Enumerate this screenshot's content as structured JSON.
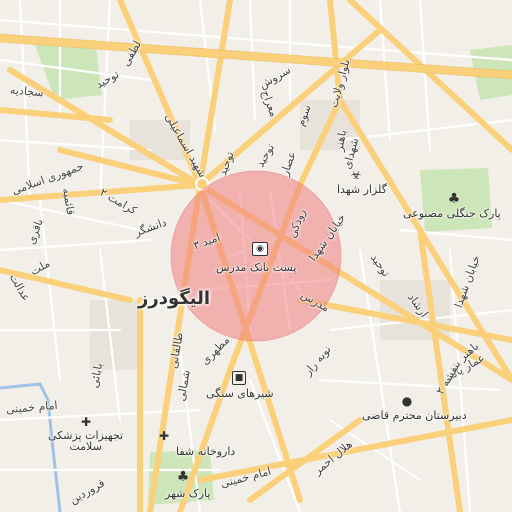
{
  "map": {
    "district_label": "الیگودرز",
    "highlight_color": "#f08080",
    "colors": {
      "background": "#f2efe9",
      "major_road": "#fdd37a",
      "minor_road": "#ffffff",
      "park": "#cfe8bd",
      "water": "#a9c9ea",
      "block": "#e4dfd6"
    },
    "pois": [
      {
        "id": "post-bank",
        "label": "پست بانک مدرس",
        "icon": "bank-icon"
      },
      {
        "id": "golzar",
        "label": "گلزار شهدا",
        "icon": "cemetery-icon"
      },
      {
        "id": "park-jangali",
        "label": "پارک جنگلی مصنوعی",
        "icon": "tree-icon"
      },
      {
        "id": "shir-sangi",
        "label": "شیرهای سنگی",
        "icon": "monument-icon"
      },
      {
        "id": "dabirestan",
        "label": "دبیرستان محترم قاضی",
        "icon": "school-icon"
      },
      {
        "id": "tajhizat",
        "label": "تجهیزات پزشکی\nسلامت",
        "icon": "pharmacy-icon"
      },
      {
        "id": "darukhane",
        "label": "داروخانه شفا",
        "icon": "pharmacy-icon"
      },
      {
        "id": "park-shahr",
        "label": "پارک شهر",
        "icon": "tree-icon"
      }
    ],
    "streets": [
      "لطفی",
      "توحید",
      "سجادیه",
      "سروش",
      "معراج",
      "بلوار ولایت",
      "سوم",
      "شهید اسماعیلی",
      "باهنر",
      "توحید",
      "توحید",
      "عصار",
      "شهدای",
      "جمهوری اسلامی",
      "قائمیه",
      "کرامت ۲",
      "دانشگر",
      "امید ۳",
      "رودکی",
      "خیابان شهدا",
      "باقری",
      "ملت",
      "خیابان شهدا",
      "مدرس",
      "توحید",
      "ارشاد",
      "عدالت",
      "طالقانی",
      "شمالی",
      "مطهری",
      "نوبه رار",
      "بابائی",
      "امام خمینی",
      "هلال احمر",
      "باهنر",
      "عمار یاسر",
      "فروردین",
      "امام خمینی",
      "بنفشه ۲"
    ]
  }
}
